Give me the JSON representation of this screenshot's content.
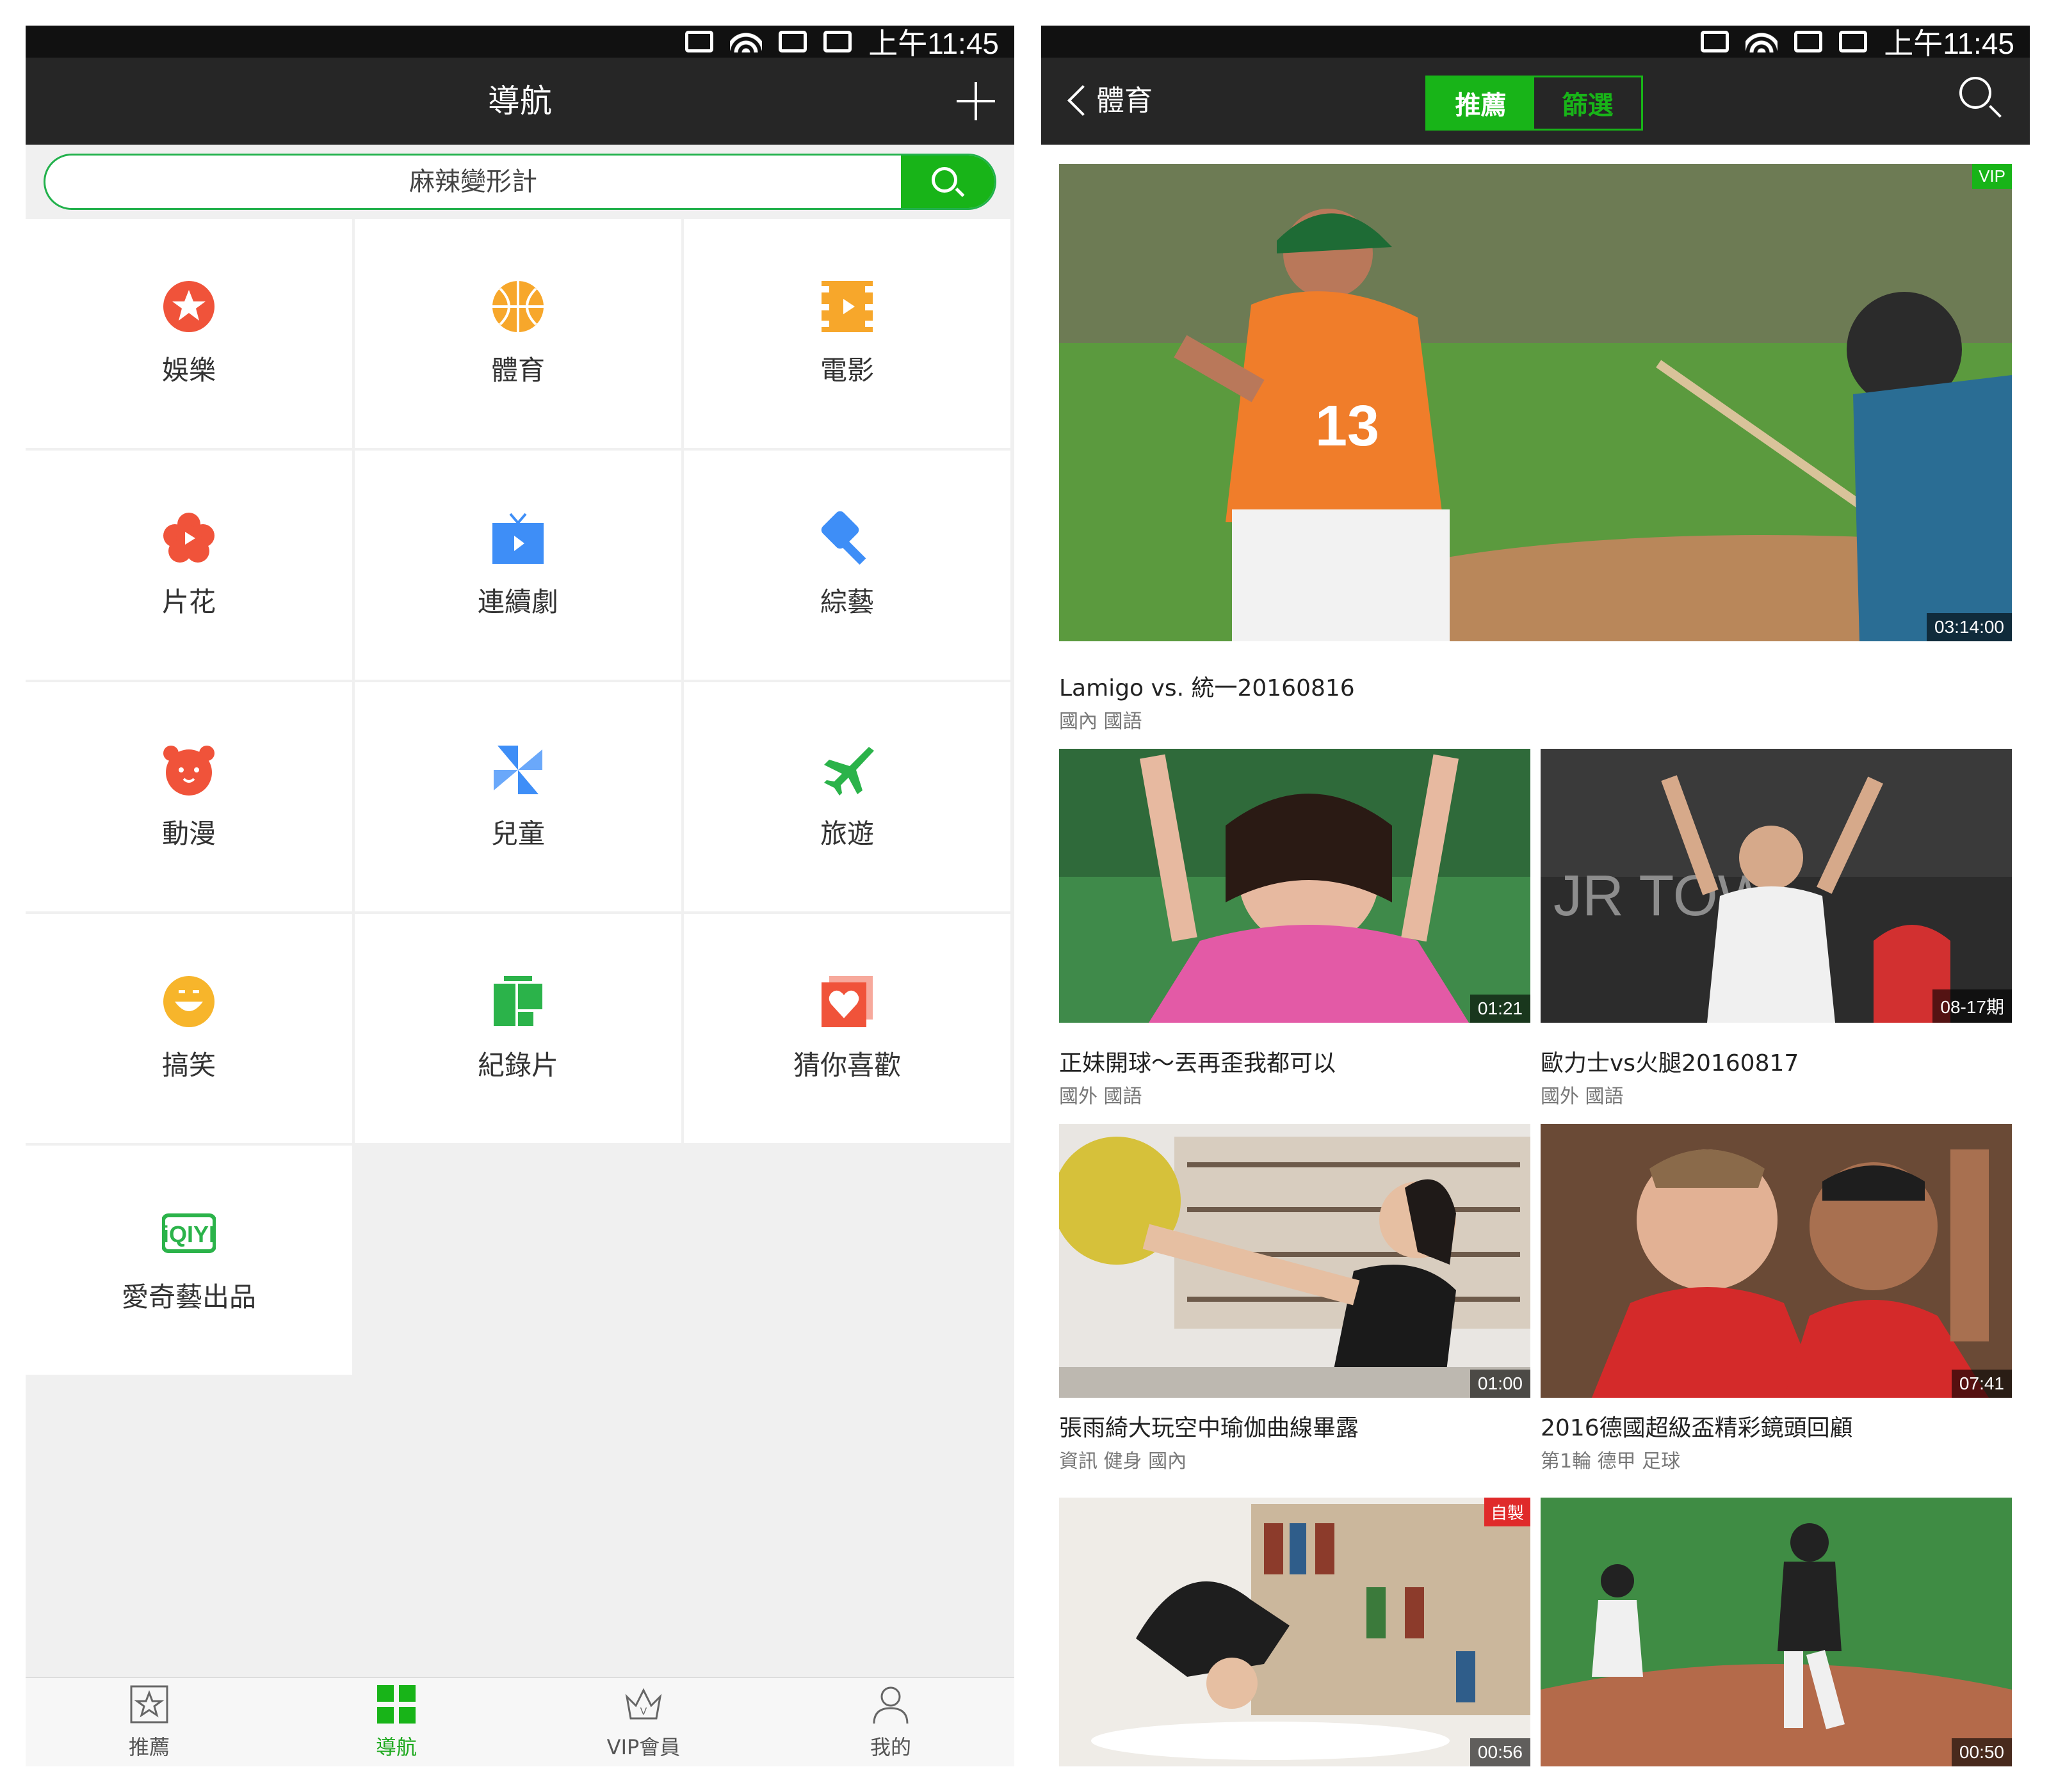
{
  "status_bar": {
    "time": "上午11:45"
  },
  "left": {
    "title": "導航",
    "search": {
      "value": "麻辣變形計"
    },
    "categories": [
      {
        "label": "娛樂",
        "icon": "star-circle-icon",
        "color": "#f0533a"
      },
      {
        "label": "體育",
        "icon": "basketball-icon",
        "color": "#f7a72b"
      },
      {
        "label": "電影",
        "icon": "film-icon",
        "color": "#f7a72b"
      },
      {
        "label": "片花",
        "icon": "flower-play-icon",
        "color": "#f0533a"
      },
      {
        "label": "連續劇",
        "icon": "tv-icon",
        "color": "#3e8ef7"
      },
      {
        "label": "綜藝",
        "icon": "microphone-icon",
        "color": "#3e8ef7"
      },
      {
        "label": "動漫",
        "icon": "bear-icon",
        "color": "#f0533a"
      },
      {
        "label": "兒童",
        "icon": "pinwheel-icon",
        "color": "#3e8ef7"
      },
      {
        "label": "旅遊",
        "icon": "airplane-icon",
        "color": "#2bb34a"
      },
      {
        "label": "搞笑",
        "icon": "smile-icon",
        "color": "#f7b52b"
      },
      {
        "label": "紀錄片",
        "icon": "documentary-icon",
        "color": "#2bb34a"
      },
      {
        "label": "猜你喜歡",
        "icon": "heart-icon",
        "color": "#f0533a"
      },
      {
        "label": "愛奇藝出品",
        "icon": "iqiyi-logo-icon",
        "color": "#2bb34a"
      }
    ],
    "tabs": [
      {
        "label": "推薦",
        "icon": "star-square-icon"
      },
      {
        "label": "導航",
        "icon": "grid-icon"
      },
      {
        "label": "VIP會員",
        "icon": "crown-icon"
      },
      {
        "label": "我的",
        "icon": "person-icon"
      }
    ],
    "active_tab": "導航",
    "accent": "#18b418"
  },
  "right": {
    "back_label": "體育",
    "segments": [
      "推薦",
      "篩選"
    ],
    "active_segment": "推薦",
    "featured": {
      "title": "Lamigo vs. 統一20160816",
      "tags": "國內 國語",
      "duration": "03:14:00",
      "badge": "VIP"
    },
    "videos": [
      {
        "title": "正妹開球～丟再歪我都可以",
        "tags": "國外 國語",
        "duration": "01:21"
      },
      {
        "title": "歐力士vs火腿20160817",
        "tags": "國外 國語",
        "duration": "08-17期"
      },
      {
        "title": "張雨綺大玩空中瑜伽曲線畢露",
        "tags": "資訊 健身 國內",
        "duration": "01:00"
      },
      {
        "title": "2016德國超級盃精彩鏡頭回顧",
        "tags": "第1輪 德甲 足球",
        "duration": "07:41"
      },
      {
        "title": "",
        "tags": "",
        "duration": "00:56",
        "badge": "自製"
      },
      {
        "title": "",
        "tags": "",
        "duration": "00:50"
      }
    ]
  }
}
